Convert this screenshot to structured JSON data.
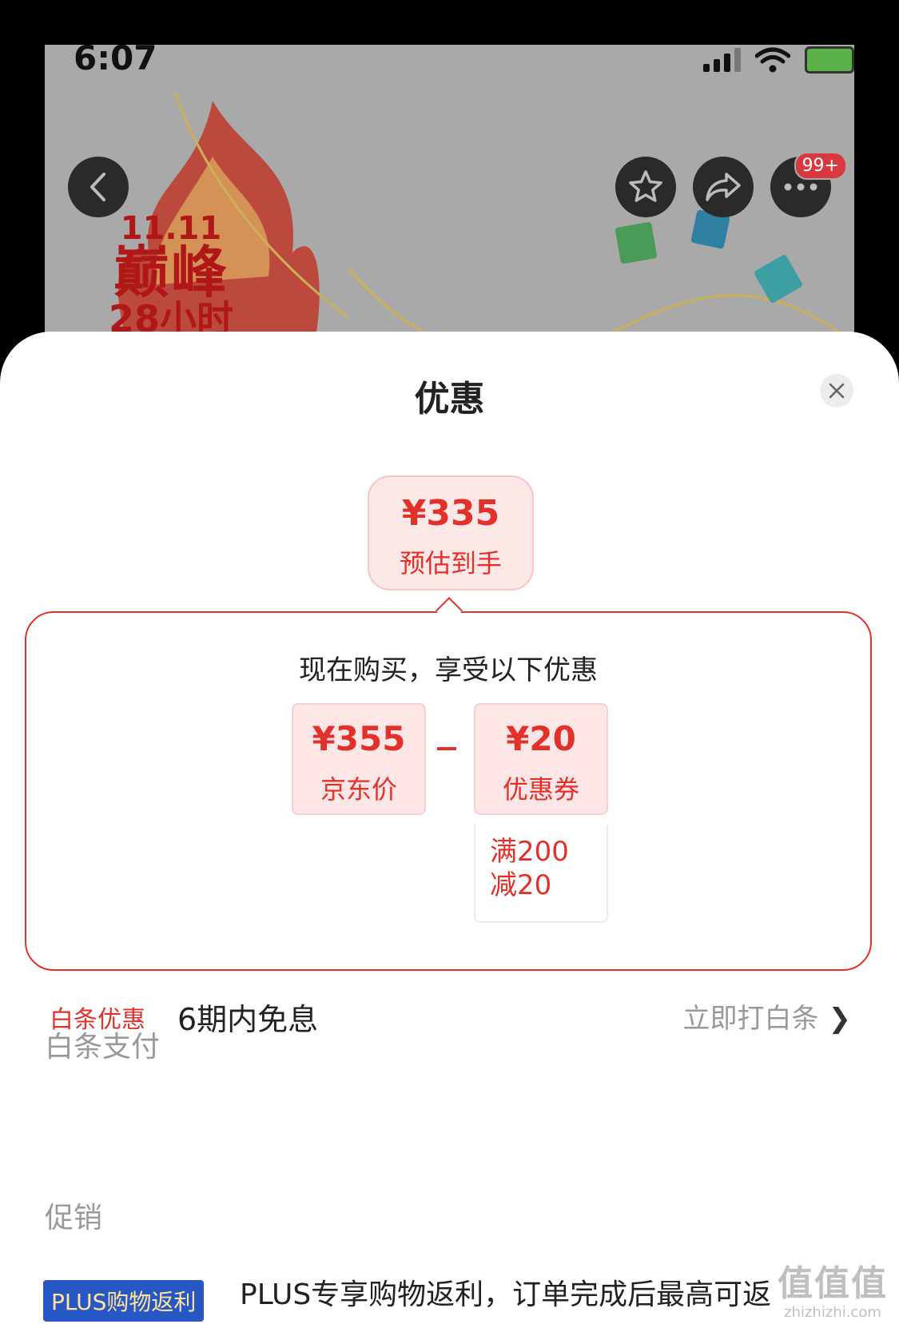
{
  "status_bar": {
    "time": "6:07"
  },
  "background": {
    "promo": {
      "line1": "11.11",
      "line2": "巅峰",
      "line3": "28小时"
    },
    "more_badge": "99+"
  },
  "sheet": {
    "title": "优惠",
    "estimate": {
      "price": "¥335",
      "label": "预估到手"
    },
    "panel": {
      "title": "现在购买，享受以下优惠",
      "jd_price": {
        "price": "¥355",
        "label": "京东价"
      },
      "coupon": {
        "price": "¥20",
        "label": "优惠券",
        "rule_line1": "满200",
        "rule_line2": "减20"
      }
    },
    "baitiao": {
      "heading": "白条支付",
      "tag": "白条优惠",
      "text": "6期内免息",
      "link": "立即打白条",
      "chevron": "❯"
    },
    "promotion": {
      "heading": "促销",
      "tag": "PLUS购物返利",
      "text": "PLUS专享购物返利，订单完成后最高可返"
    },
    "watermark": {
      "main": "值值值",
      "sub": "zhizhizhi.com"
    }
  },
  "colors": {
    "accent": "#e2312b",
    "coupon_bg": "#fde6e6",
    "plus_blue": "#2657c4"
  }
}
